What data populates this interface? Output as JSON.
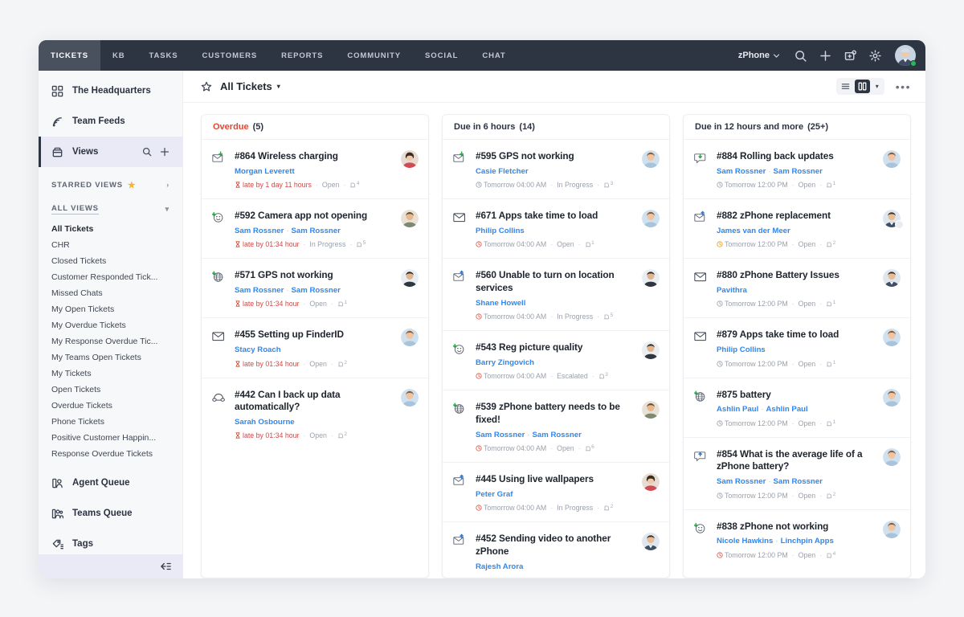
{
  "topnav": {
    "tabs": [
      {
        "label": "TICKETS",
        "active": true
      },
      {
        "label": "KB",
        "active": false
      },
      {
        "label": "TASKS",
        "active": false
      },
      {
        "label": "CUSTOMERS",
        "active": false
      },
      {
        "label": "REPORTS",
        "active": false
      },
      {
        "label": "COMMUNITY",
        "active": false
      },
      {
        "label": "SOCIAL",
        "active": false
      },
      {
        "label": "CHAT",
        "active": false
      }
    ],
    "brand_label": "zPhone",
    "icons": [
      "search-icon",
      "plus-icon",
      "announcement-icon",
      "gear-icon"
    ],
    "status": "online"
  },
  "sidebar": {
    "primary": [
      {
        "label": "The Headquarters",
        "icon": "grid-icon",
        "active": false
      },
      {
        "label": "Team Feeds",
        "icon": "feed-icon",
        "active": false
      },
      {
        "label": "Views",
        "icon": "views-icon",
        "active": true
      }
    ],
    "starred_section": {
      "label": "STARRED VIEWS",
      "star": "★",
      "caret": "›"
    },
    "all_section": {
      "label": "ALL VIEWS",
      "caret": "▾"
    },
    "views": [
      {
        "label": "All Tickets",
        "current": true
      },
      {
        "label": "CHR",
        "current": false
      },
      {
        "label": "Closed Tickets",
        "current": false
      },
      {
        "label": "Customer Responded Tick...",
        "current": false
      },
      {
        "label": "Missed Chats",
        "current": false
      },
      {
        "label": "My Open Tickets",
        "current": false
      },
      {
        "label": "My Overdue Tickets",
        "current": false
      },
      {
        "label": "My Response Overdue Tic...",
        "current": false
      },
      {
        "label": "My Teams Open Tickets",
        "current": false
      },
      {
        "label": "My Tickets",
        "current": false
      },
      {
        "label": "Open Tickets",
        "current": false
      },
      {
        "label": "Overdue Tickets",
        "current": false
      },
      {
        "label": "Phone Tickets",
        "current": false
      },
      {
        "label": "Positive Customer Happin...",
        "current": false
      },
      {
        "label": "Response Overdue Tickets",
        "current": false
      }
    ],
    "secondary": [
      {
        "label": "Agent Queue",
        "icon": "agent-queue-icon"
      },
      {
        "label": "Teams Queue",
        "icon": "teams-queue-icon"
      },
      {
        "label": "Tags",
        "icon": "tags-icon"
      }
    ],
    "collapse_icon": "collapse-sidebar-icon"
  },
  "toolbar": {
    "star_icon": "star-outline-icon",
    "title": "All Tickets",
    "title_caret": "▾",
    "view_list_icon": "list-view-icon",
    "view_card_icon": "card-view-icon",
    "view_caret": "▾",
    "more_icon": "more-options-icon",
    "more_label": "•••"
  },
  "board": {
    "columns": [
      {
        "title": "Overdue",
        "title_color": "#e8452f",
        "count": "(5)",
        "cards": [
          {
            "id": "#864",
            "title": "#864 Wireless charging",
            "people": [
              "Morgan Leverett"
            ],
            "due": "late by 1 day 11 hours",
            "due_state": "late",
            "status": "Open",
            "notes": "4",
            "icon": "email-received-icon",
            "avatar": "av-woman-1",
            "multi_avatar": false
          },
          {
            "id": "#592",
            "title": "#592 Camera app not opening",
            "people": [
              "Sam Rossner",
              "Sam Rossner"
            ],
            "due": "late by 01:34 hour",
            "due_state": "late",
            "status": "In Progress",
            "notes": "5",
            "icon": "feedback-icon",
            "avatar": "av-man-1",
            "multi_avatar": false
          },
          {
            "id": "#571",
            "title": "#571 GPS not working",
            "people": [
              "Sam Rossner",
              "Sam Rossner"
            ],
            "due": "late by 01:34 hour",
            "due_state": "late",
            "status": "Open",
            "notes": "1",
            "icon": "portal-icon",
            "avatar": "av-man-2",
            "multi_avatar": false
          },
          {
            "id": "#455",
            "title": "#455 Setting up FinderID",
            "people": [
              "Stacy Roach"
            ],
            "due": "late by 01:34 hour",
            "due_state": "late",
            "status": "Open",
            "notes": "2",
            "icon": "email-icon",
            "avatar": "av-woman-2",
            "multi_avatar": false
          },
          {
            "id": "#442",
            "title": "#442 Can I back up data automatically?",
            "people": [
              "Sarah Osbourne"
            ],
            "due": "late by 01:34 hour",
            "due_state": "late",
            "status": "Open",
            "notes": "2",
            "icon": "phone-icon",
            "avatar": "av-woman-2",
            "multi_avatar": false
          }
        ]
      },
      {
        "title": "Due in 6 hours",
        "title_color": "#2b3240",
        "count": "(14)",
        "cards": [
          {
            "id": "#595",
            "title": "#595 GPS not working",
            "people": [
              "Casie Fletcher"
            ],
            "due": "Tomorrow 04:00 AM",
            "due_state": "ok",
            "status": "In Progress",
            "notes": "3",
            "icon": "email-received-icon",
            "avatar": "av-woman-2",
            "multi_avatar": false
          },
          {
            "id": "#671",
            "title": "#671 Apps take time to load",
            "people": [
              "Philip Collins"
            ],
            "due": "Tomorrow 04:00 AM",
            "due_state": "warn",
            "status": "Open",
            "notes": "1",
            "icon": "email-icon",
            "avatar": "av-woman-2",
            "multi_avatar": false
          },
          {
            "id": "#560",
            "title": "#560 Unable to turn on location services",
            "people": [
              "Shane Howell"
            ],
            "due": "Tomorrow 04:00 AM",
            "due_state": "warn",
            "status": "In Progress",
            "notes": "5",
            "icon": "email-sent-icon",
            "avatar": "av-man-2",
            "multi_avatar": false
          },
          {
            "id": "#543",
            "title": "#543 Reg picture quality",
            "people": [
              "Barry Zingovich"
            ],
            "due": "Tomorrow 04:00 AM",
            "due_state": "warn",
            "status": "Escalated",
            "notes": "3",
            "icon": "feedback-icon",
            "avatar": "av-man-2",
            "multi_avatar": false
          },
          {
            "id": "#539",
            "title": "#539 zPhone battery needs to be fixed!",
            "people": [
              "Sam Rossner",
              "Sam Rossner"
            ],
            "due": "Tomorrow 04:00 AM",
            "due_state": "warn",
            "status": "Open",
            "notes": "6",
            "icon": "portal-icon",
            "avatar": "av-man-1",
            "multi_avatar": false
          },
          {
            "id": "#445",
            "title": "#445 Using live wallpapers",
            "people": [
              "Peter Graf"
            ],
            "due": "Tomorrow 04:00 AM",
            "due_state": "warn",
            "status": "In Progress",
            "notes": "2",
            "icon": "email-sent-icon",
            "avatar": "av-woman-1",
            "multi_avatar": false
          },
          {
            "id": "#452",
            "title": "#452 Sending video to another zPhone",
            "people": [
              "Rajesh Arora"
            ],
            "due": "",
            "due_state": "none",
            "status": "",
            "notes": "",
            "icon": "email-sent-icon",
            "avatar": "av-man-3",
            "multi_avatar": false
          }
        ]
      },
      {
        "title": "Due in 12 hours and more",
        "title_color": "#2b3240",
        "count": "(25+)",
        "cards": [
          {
            "id": "#884",
            "title": "#884 Rolling back updates",
            "people": [
              "Sam Rossner",
              "Sam Rossner"
            ],
            "due": "Tomorrow 12:00 PM",
            "due_state": "ok",
            "status": "Open",
            "notes": "1",
            "icon": "chat-received-icon",
            "avatar": "av-woman-2",
            "multi_avatar": false
          },
          {
            "id": "#882",
            "title": "#882 zPhone replacement",
            "people": [
              "James van der Meer"
            ],
            "due": "Tomorrow 12:00 PM",
            "due_state": "amber",
            "status": "Open",
            "notes": "2",
            "icon": "email-sent-icon",
            "avatar": "av-man-3",
            "multi_avatar": true
          },
          {
            "id": "#880",
            "title": "#880 zPhone Battery Issues",
            "people": [
              "Pavithra"
            ],
            "due": "Tomorrow 12:00 PM",
            "due_state": "ok",
            "status": "Open",
            "notes": "1",
            "icon": "email-icon",
            "avatar": "av-man-3",
            "multi_avatar": false
          },
          {
            "id": "#879",
            "title": "#879 Apps take time to load",
            "people": [
              "Philip Collins"
            ],
            "due": "Tomorrow 12:00 PM",
            "due_state": "ok",
            "status": "Open",
            "notes": "1",
            "icon": "email-icon",
            "avatar": "av-woman-2",
            "multi_avatar": false
          },
          {
            "id": "#875",
            "title": "#875 battery",
            "people": [
              "Ashlin Paul",
              "Ashlin Paul"
            ],
            "due": "Tomorrow 12:00 PM",
            "due_state": "ok",
            "status": "Open",
            "notes": "1",
            "icon": "portal-icon",
            "avatar": "av-woman-2",
            "multi_avatar": false
          },
          {
            "id": "#854",
            "title": "#854 What is the average life of a zPhone battery?",
            "people": [
              "Sam Rossner",
              "Sam Rossner"
            ],
            "due": "Tomorrow 12:00 PM",
            "due_state": "ok",
            "status": "Open",
            "notes": "2",
            "icon": "chat-sent-icon",
            "avatar": "av-woman-2",
            "multi_avatar": false
          },
          {
            "id": "#838",
            "title": "#838 zPhone not working",
            "people": [
              "Nicole Hawkins",
              "Linchpin Apps"
            ],
            "due": "Tomorrow 12:00 PM",
            "due_state": "warn",
            "status": "Open",
            "notes": "4",
            "icon": "feedback-icon",
            "avatar": "av-woman-2",
            "multi_avatar": false
          }
        ]
      }
    ]
  }
}
